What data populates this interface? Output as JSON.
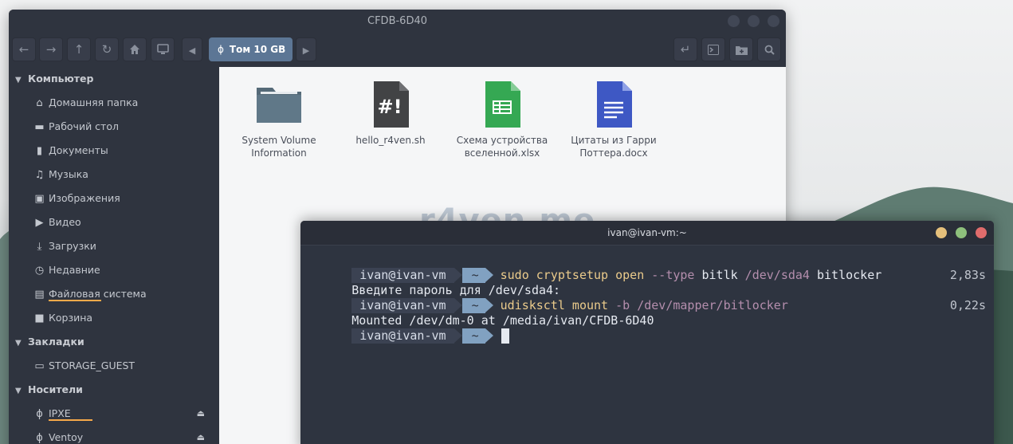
{
  "file_manager": {
    "title": "CFDB-6D40",
    "toolbar": {
      "back_icon": "arrow-left",
      "forward_icon": "arrow-right",
      "up_icon": "arrow-up",
      "reload_icon": "reload",
      "home_icon": "home",
      "computer_icon": "monitor",
      "path_label": "Том 10 GB"
    },
    "sidebar": {
      "sections": [
        {
          "title": "Компьютер",
          "items": [
            {
              "label": "Домашняя папка",
              "icon": "home"
            },
            {
              "label": "Рабочий стол",
              "icon": "desktop"
            },
            {
              "label": "Документы",
              "icon": "document"
            },
            {
              "label": "Музыка",
              "icon": "music"
            },
            {
              "label": "Изображения",
              "icon": "image"
            },
            {
              "label": "Видео",
              "icon": "video"
            },
            {
              "label": "Загрузки",
              "icon": "download"
            },
            {
              "label": "Недавние",
              "icon": "clock"
            },
            {
              "label": "Файловая система",
              "icon": "drive"
            },
            {
              "label": "Корзина",
              "icon": "trash"
            }
          ]
        },
        {
          "title": "Закладки",
          "items": [
            {
              "label": "STORAGE_GUEST",
              "icon": "folder"
            }
          ]
        },
        {
          "title": "Носители",
          "items": [
            {
              "label": "IPXE",
              "icon": "usb"
            },
            {
              "label": "Ventoy",
              "icon": "usb"
            }
          ]
        }
      ]
    },
    "files": [
      {
        "name_line1": "System Volume",
        "name_line2": "Information",
        "type": "folder"
      },
      {
        "name_line1": "hello_r4ven.sh",
        "name_line2": "",
        "type": "script"
      },
      {
        "name_line1": "Схема устройства",
        "name_line2": "вселенной.xlsx",
        "type": "spreadsheet"
      },
      {
        "name_line1": "Цитаты из Гарри",
        "name_line2": "Поттера.docx",
        "type": "document"
      }
    ]
  },
  "watermark": "r4ven.me",
  "terminal": {
    "title": "ivan@ivan-vm:~",
    "prompt_user": "ivan@ivan-vm",
    "prompt_dir": "~",
    "lines": [
      {
        "kind": "prompt",
        "cmd": "sudo",
        "parts": [
          " cryptsetup",
          " open",
          " --type",
          " bitlk",
          " /dev/sda4",
          " bitlocker"
        ],
        "timing": ""
      },
      {
        "kind": "output",
        "text": "Введите пароль для /dev/sda4:",
        "timing": "2,83s"
      },
      {
        "kind": "prompt",
        "cmd": "udisksctl",
        "parts": [
          " mount",
          " -b",
          " /dev/mapper/bitlocker"
        ],
        "timing": ""
      },
      {
        "kind": "output",
        "text": "Mounted /dev/dm-0 at /media/ivan/CFDB-6D40",
        "timing": "0,22s"
      }
    ]
  },
  "colors": {
    "accent": "#5c7695",
    "terminal_bg": "#2e3440",
    "close_dot": "#e06c6c",
    "max_dot": "#8ec07c",
    "min_dot": "#e5c07b"
  }
}
